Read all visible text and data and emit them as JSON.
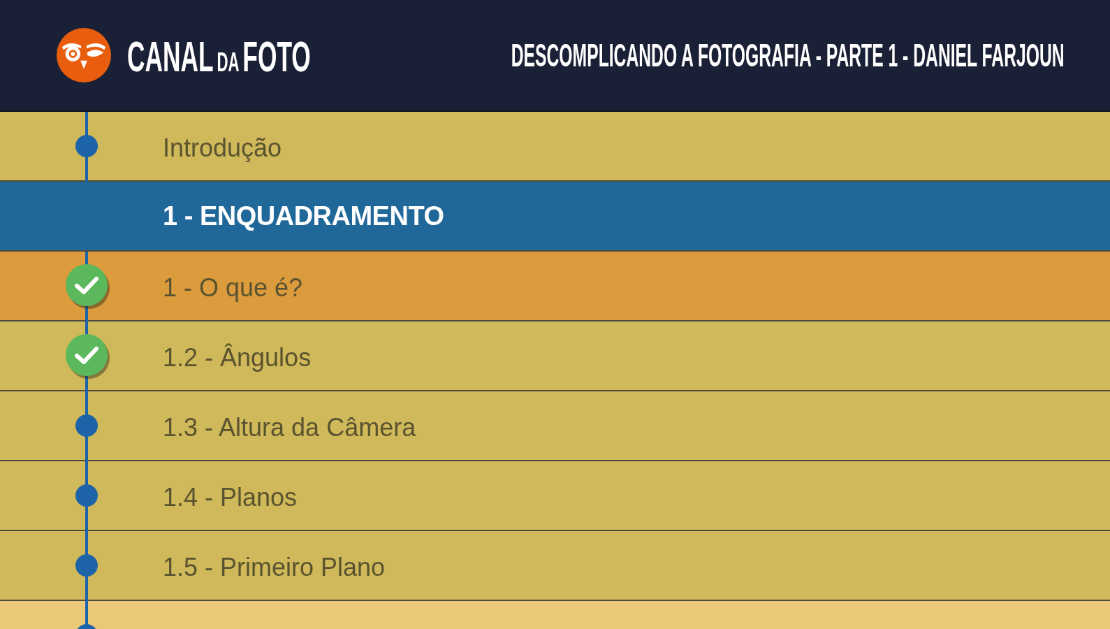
{
  "header": {
    "logo": {
      "words": [
        {
          "text": "CANAL",
          "kind": "large"
        },
        {
          "text": "DA",
          "kind": "small"
        },
        {
          "text": "FOTO",
          "kind": "large"
        }
      ]
    },
    "title": "DESCOMPLICANDO A FOTOGRAFIA - PARTE 1 - DANIEL FARJOUN"
  },
  "rows": [
    {
      "kind": "lesson",
      "label": "Introdução",
      "completed": false,
      "selected": false,
      "hovered": false
    },
    {
      "kind": "section",
      "label": "1 - ENQUADRAMENTO"
    },
    {
      "kind": "lesson",
      "label": "1 - O que é?",
      "completed": true,
      "selected": true,
      "hovered": false
    },
    {
      "kind": "lesson",
      "label": "1.2 - Ângulos",
      "completed": true,
      "selected": false,
      "hovered": false
    },
    {
      "kind": "lesson",
      "label": "1.3 - Altura da Câmera",
      "completed": false,
      "selected": false,
      "hovered": false
    },
    {
      "kind": "lesson",
      "label": "1.4 - Planos",
      "completed": false,
      "selected": false,
      "hovered": false
    },
    {
      "kind": "lesson",
      "label": "1.5 - Primeiro Plano",
      "completed": false,
      "selected": false,
      "hovered": false
    },
    {
      "kind": "lesson",
      "completed": false,
      "selected": false,
      "hovered": true
    }
  ]
}
